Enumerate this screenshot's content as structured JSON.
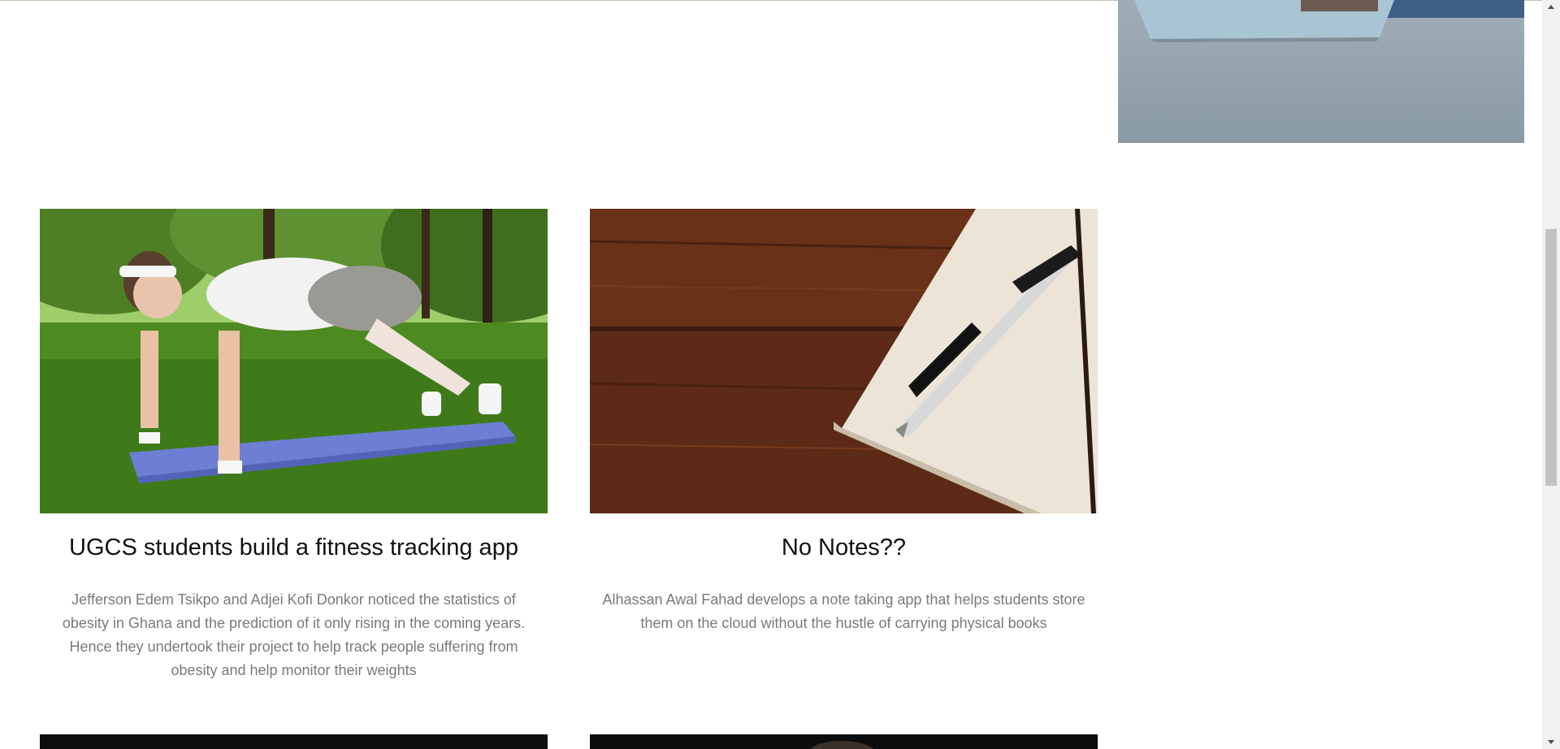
{
  "cards": [
    {
      "title": "UGCS students build a fitness tracking app",
      "description": "Jefferson Edem Tsikpo and Adjei Kofi Donkor noticed the statistics of obesity in Ghana and the prediction of it only rising in the coming years. Hence they undertook their project to help track people suffering from obesity and help monitor their weights"
    },
    {
      "title": "No Notes??",
      "description": "Alhassan Awal Fahad develops a note taking app that helps students store them on the cloud without the hustle of carrying physical books"
    }
  ],
  "colors": {
    "title": "#111111",
    "description": "#7a7a7a",
    "scrollbar_track": "#f1f1f1",
    "scrollbar_thumb": "#c1c1c1"
  }
}
